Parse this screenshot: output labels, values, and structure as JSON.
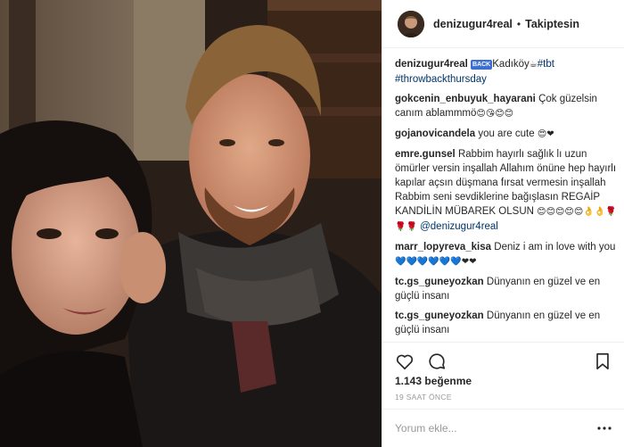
{
  "post": {
    "header": {
      "username": "denizugur4real",
      "separator": "•",
      "follow_status": "Takiptesin"
    },
    "caption": {
      "username": "denizugur4real",
      "badge": "BACK",
      "text_before": " ",
      "location": "Kadıköy",
      "emoji": "☕",
      "hashtags": "#tbt",
      "hashtags2": "#throwbackthursday"
    },
    "comments": [
      {
        "user": "gokcenin_enbuyuk_hayarani",
        "text": "Çok güzelsin canım ablammmö",
        "emoji": "😊😘😊😊"
      },
      {
        "user": "gojanovicandela",
        "text": "you are cute",
        "emoji": "😍❤"
      },
      {
        "user": "emre.gunsel",
        "text": "Rabbim hayırlı sağlık lı uzun ömürler versin inşallah Allahım önüne hep hayırlı kapılar açsın düşmana fırsat vermesin inşallah Rabbim seni sevdiklerine bağışlasın REGAİP KANDİLİN MÜBAREK OLSUN",
        "emoji": "😊😊😊😊😊👌👌🌹🌹🌹",
        "mention": "@denizugur4real"
      },
      {
        "user": "marr_lopyreva_kisa",
        "text": "Deniz i am in love with you",
        "emoji": "💙💙💙💙💙💙❤❤"
      },
      {
        "user": "tc.gs_guneyozkan",
        "text": "Dünyanın en güzel ve en güçlü insanı"
      },
      {
        "user": "tc.gs_guneyozkan",
        "text": "Dünyanın en güzel ve en güçlü insanı"
      }
    ],
    "actions": {
      "like_icon": "heart-icon",
      "comment_icon": "comment-bubble-icon",
      "save_icon": "bookmark-icon"
    },
    "likes": "1.143 beğenme",
    "time_ago": "19 SAAT ÖNCE",
    "add_comment": {
      "placeholder": "Yorum ekle...",
      "more_icon": "ellipsis-icon"
    }
  }
}
